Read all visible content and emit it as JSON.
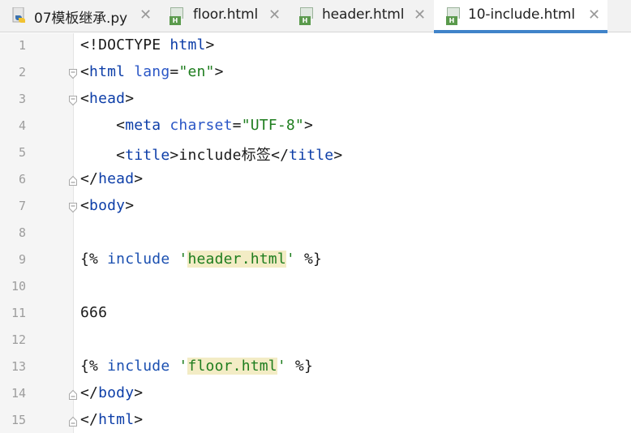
{
  "tabs": [
    {
      "label": "07模板继承.py",
      "icon": "python-file-icon",
      "active": false,
      "close": "✕"
    },
    {
      "label": "floor.html",
      "icon": "html-file-icon",
      "active": false,
      "close": "✕"
    },
    {
      "label": "header.html",
      "icon": "html-file-icon",
      "active": false,
      "close": "✕"
    },
    {
      "label": "10-include.html",
      "icon": "html-file-icon",
      "active": true,
      "close": "✕"
    }
  ],
  "html_badge": "H",
  "editor": {
    "lines": [
      {
        "n": "1",
        "code": [
          [
            "t-tag",
            "<!DOCTYPE "
          ],
          [
            "t-name",
            "html"
          ],
          [
            "t-tag",
            ">"
          ]
        ],
        "fold": ""
      },
      {
        "n": "2",
        "code": [
          [
            "t-tag",
            "<"
          ],
          [
            "t-name",
            "html "
          ],
          [
            "t-attr",
            "lang"
          ],
          [
            "t-tag",
            "="
          ],
          [
            "t-val",
            "\"en\""
          ],
          [
            "t-tag",
            ">"
          ]
        ],
        "fold": "open"
      },
      {
        "n": "3",
        "code": [
          [
            "t-tag",
            "<"
          ],
          [
            "t-name",
            "head"
          ],
          [
            "t-tag",
            ">"
          ]
        ],
        "fold": "open"
      },
      {
        "n": "4",
        "code": [
          [
            "t-tag",
            "    <"
          ],
          [
            "t-name",
            "meta "
          ],
          [
            "t-attr",
            "charset"
          ],
          [
            "t-tag",
            "="
          ],
          [
            "t-val",
            "\"UTF-8\""
          ],
          [
            "t-tag",
            ">"
          ]
        ],
        "fold": ""
      },
      {
        "n": "5",
        "code": [
          [
            "t-tag",
            "    <"
          ],
          [
            "t-name",
            "title"
          ],
          [
            "t-tag",
            ">include标签</"
          ],
          [
            "t-name",
            "title"
          ],
          [
            "t-tag",
            ">"
          ]
        ],
        "fold": ""
      },
      {
        "n": "6",
        "code": [
          [
            "t-tag",
            "</"
          ],
          [
            "t-name",
            "head"
          ],
          [
            "t-tag",
            ">"
          ]
        ],
        "fold": "close"
      },
      {
        "n": "7",
        "code": [
          [
            "t-tag",
            "<"
          ],
          [
            "t-name",
            "body"
          ],
          [
            "t-tag",
            ">"
          ]
        ],
        "fold": "open"
      },
      {
        "n": "8",
        "code": [],
        "fold": ""
      },
      {
        "n": "9",
        "code": [
          [
            "t-tag",
            "{% "
          ],
          [
            "t-kw",
            "include "
          ],
          [
            "t-str",
            "'"
          ],
          [
            "t-str hl",
            "header.html"
          ],
          [
            "t-str",
            "'"
          ],
          [
            "t-tag",
            " %}"
          ]
        ],
        "fold": ""
      },
      {
        "n": "10",
        "code": [],
        "fold": ""
      },
      {
        "n": "11",
        "code": [
          [
            "t-tag",
            "666"
          ]
        ],
        "fold": ""
      },
      {
        "n": "12",
        "code": [],
        "fold": ""
      },
      {
        "n": "13",
        "code": [
          [
            "t-tag",
            "{% "
          ],
          [
            "t-kw",
            "include "
          ],
          [
            "t-str",
            "'"
          ],
          [
            "t-str hl",
            "floor.html"
          ],
          [
            "t-str",
            "'"
          ],
          [
            "t-tag",
            " %}"
          ]
        ],
        "fold": ""
      },
      {
        "n": "14",
        "code": [
          [
            "t-tag",
            "</"
          ],
          [
            "t-name",
            "body"
          ],
          [
            "t-tag",
            ">"
          ]
        ],
        "fold": "close"
      },
      {
        "n": "15",
        "code": [
          [
            "t-tag",
            "</"
          ],
          [
            "t-name",
            "html"
          ],
          [
            "t-tag",
            ">"
          ]
        ],
        "fold": "close"
      }
    ]
  },
  "colors": {
    "accent": "#4083c9",
    "html_icon": "#5a9a4c",
    "highlight": "#f3ecc5"
  }
}
